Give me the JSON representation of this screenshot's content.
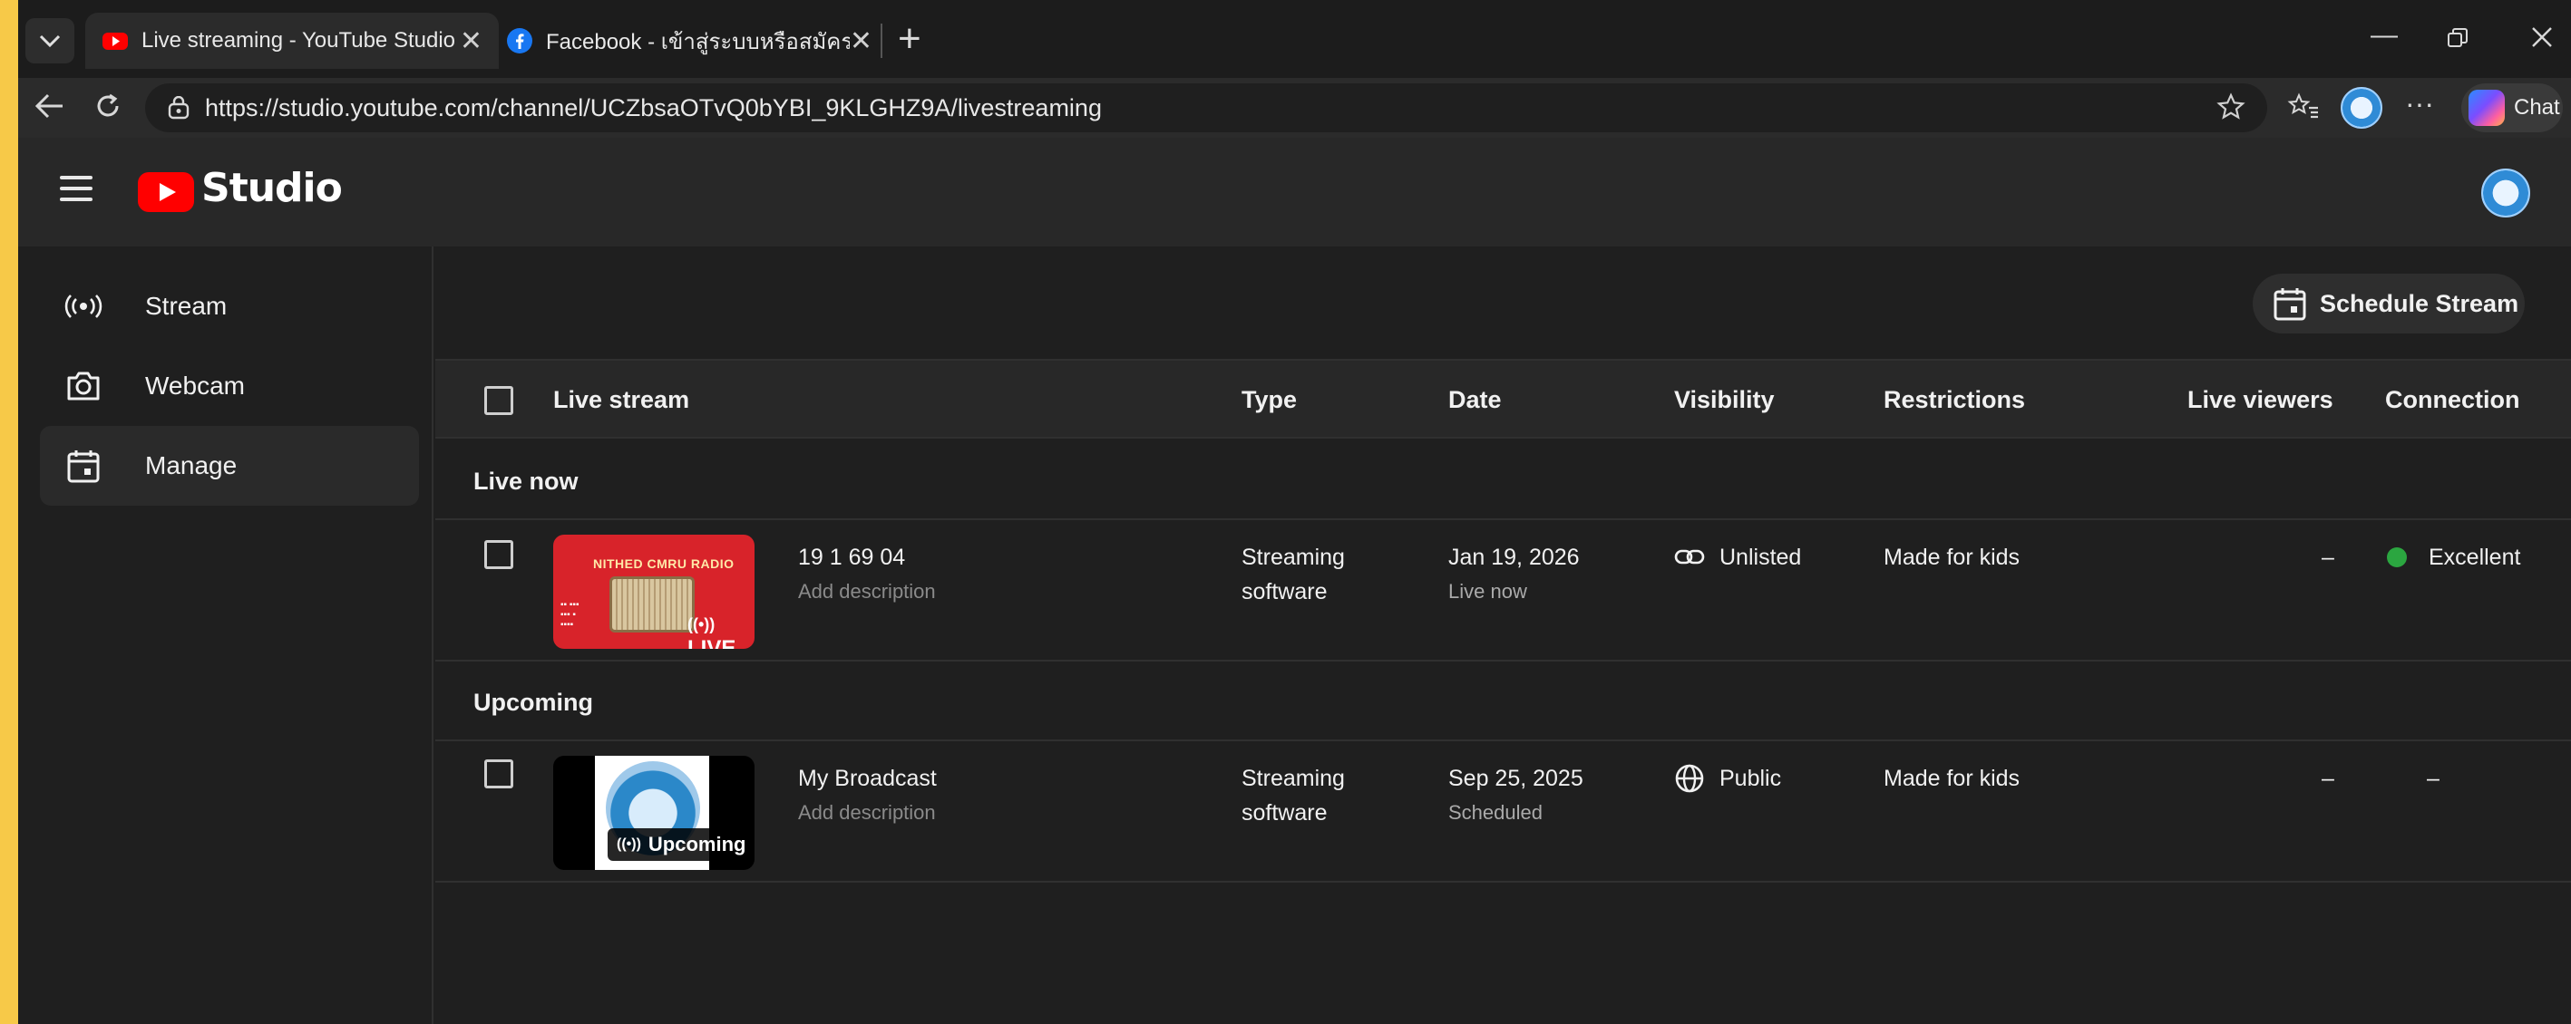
{
  "browser": {
    "tabs": [
      {
        "title": "Live streaming - YouTube Studio",
        "active": true
      },
      {
        "title": "Facebook - เข้าสู่ระบบหรือสมัครใช้งาน",
        "active": false
      }
    ],
    "tab_close": "✕",
    "new_tab": "+",
    "url": "https://studio.youtube.com/channel/UCZbsaOTvQ0bYBI_9KLGHZ9A/livestreaming",
    "chat_label": "Chat"
  },
  "studio": {
    "brand": "Studio"
  },
  "sidebar": {
    "items": [
      {
        "label": "Stream",
        "icon": "live-broadcast-icon"
      },
      {
        "label": "Webcam",
        "icon": "camera-icon"
      },
      {
        "label": "Manage",
        "icon": "calendar-icon",
        "active": true
      }
    ]
  },
  "toolbar": {
    "schedule_label": "Schedule Stream"
  },
  "table": {
    "columns": [
      "Live stream",
      "Type",
      "Date",
      "Visibility",
      "Restrictions",
      "Live viewers",
      "Connection"
    ],
    "sections": [
      {
        "label": "Live now",
        "rows": [
          {
            "title": "19 1 69 04",
            "description": "Add description",
            "thumb_badge": "LIVE",
            "thumb_text": "NITHED CMRU RADIO",
            "type_line1": "Streaming",
            "type_line2": "software",
            "date": "Jan 19, 2026",
            "date_status": "Live now",
            "visibility": "Unlisted",
            "restrictions": "Made for kids",
            "live_viewers": "–",
            "connection": "Excellent",
            "connection_color": "#2ba640"
          }
        ]
      },
      {
        "label": "Upcoming",
        "rows": [
          {
            "title": "My Broadcast",
            "description": "Add description",
            "thumb_badge": "Upcoming",
            "type_line1": "Streaming",
            "type_line2": "software",
            "date": "Sep 25, 2025",
            "date_status": "Scheduled",
            "visibility": "Public",
            "restrictions": "Made for kids",
            "live_viewers": "–",
            "connection": "–"
          }
        ]
      }
    ]
  },
  "colors": {
    "page_frame": "#f7c948",
    "youtube_red": "#ff0000",
    "excellent_green": "#2ba640"
  }
}
